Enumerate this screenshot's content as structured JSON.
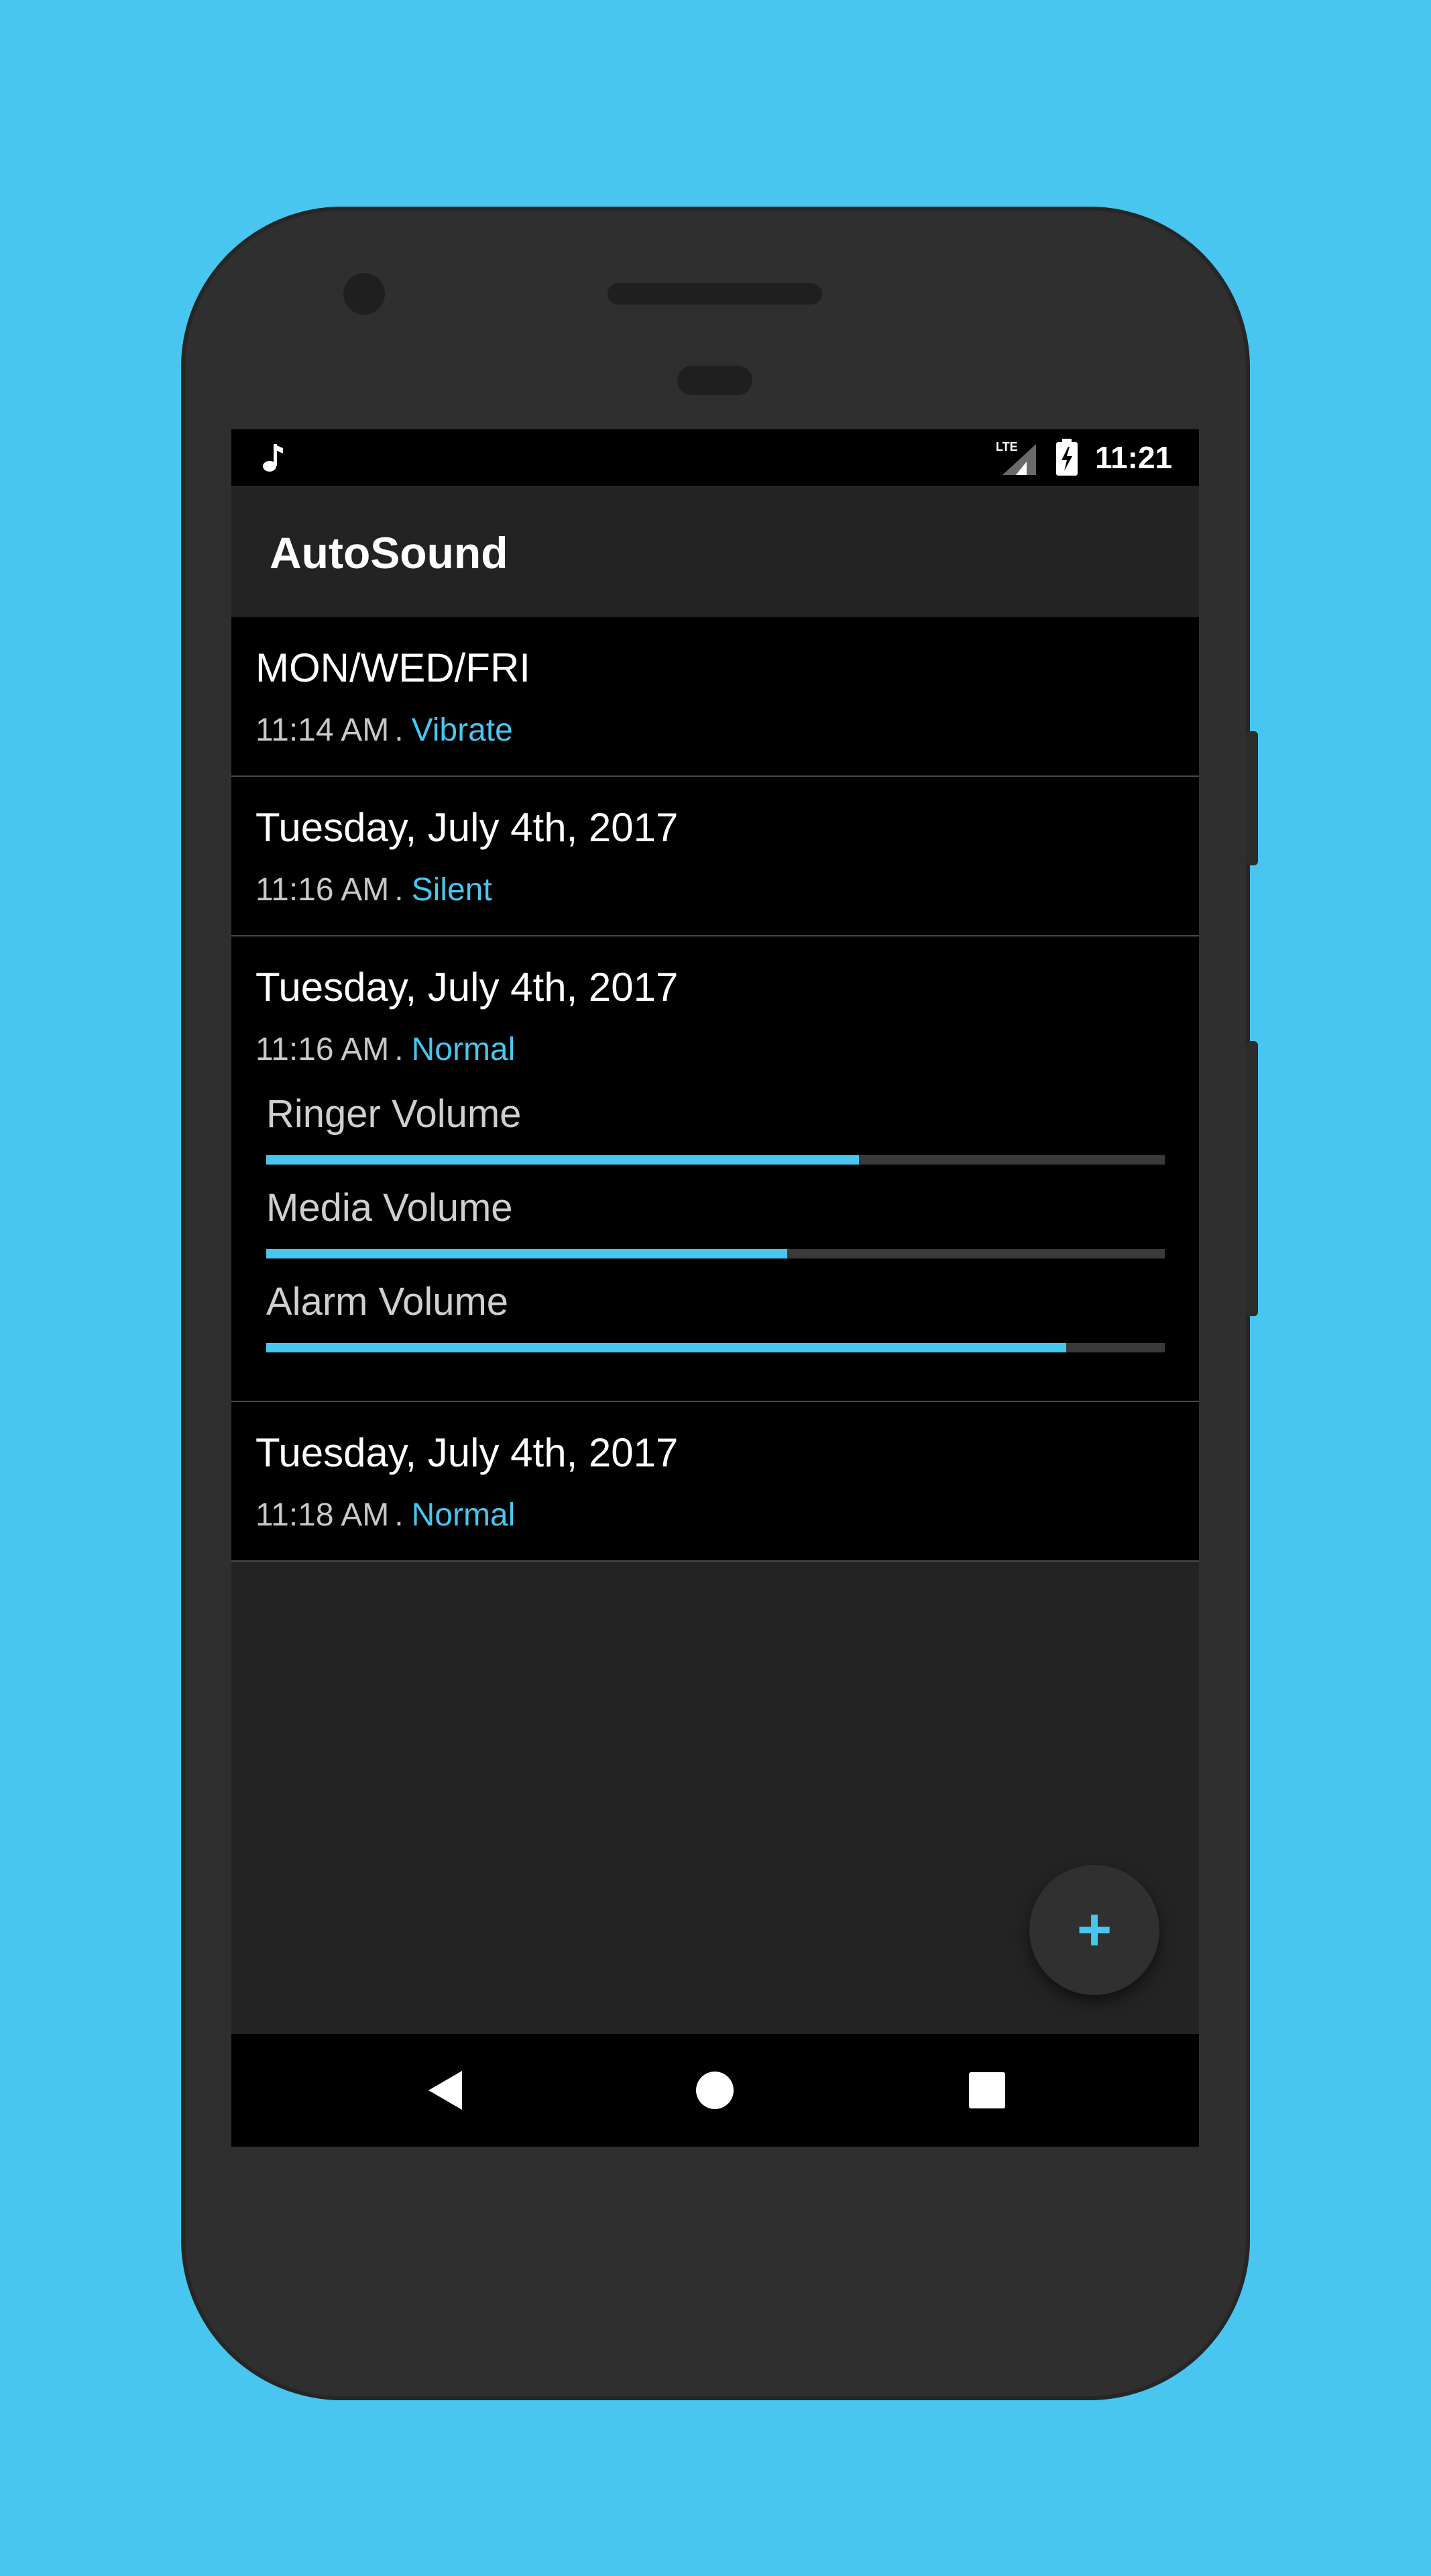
{
  "status_bar": {
    "clock": "11:21",
    "lte_label": "LTE",
    "icons": [
      "music-note-icon",
      "lte-signal-icon",
      "battery-charging-icon"
    ]
  },
  "app_bar": {
    "title": "AutoSound"
  },
  "entries": [
    {
      "title": "MON/WED/FRI",
      "time": "11:14 AM",
      "separator": ".",
      "mode": "Vibrate"
    },
    {
      "title": "Tuesday, July 4th, 2017",
      "time": "11:16 AM",
      "separator": ".",
      "mode": "Silent"
    },
    {
      "title": "Tuesday, July 4th, 2017",
      "time": "11:16 AM",
      "separator": ".",
      "mode": "Normal",
      "volumes": [
        {
          "label": "Ringer Volume",
          "level": 0.66
        },
        {
          "label": "Media Volume",
          "level": 0.58
        },
        {
          "label": "Alarm Volume",
          "level": 0.89
        }
      ]
    },
    {
      "title": "Tuesday, July 4th, 2017",
      "time": "11:18 AM",
      "separator": ".",
      "mode": "Normal"
    }
  ],
  "fab": {
    "label": "+",
    "icon": "add-icon"
  },
  "nav_bar": {
    "icons": [
      "back-icon",
      "home-icon",
      "recents-icon"
    ]
  },
  "colors": {
    "accent": "#48c6f0",
    "background": "#48c6f0",
    "screen": "#232323",
    "list_item": "#000000"
  }
}
